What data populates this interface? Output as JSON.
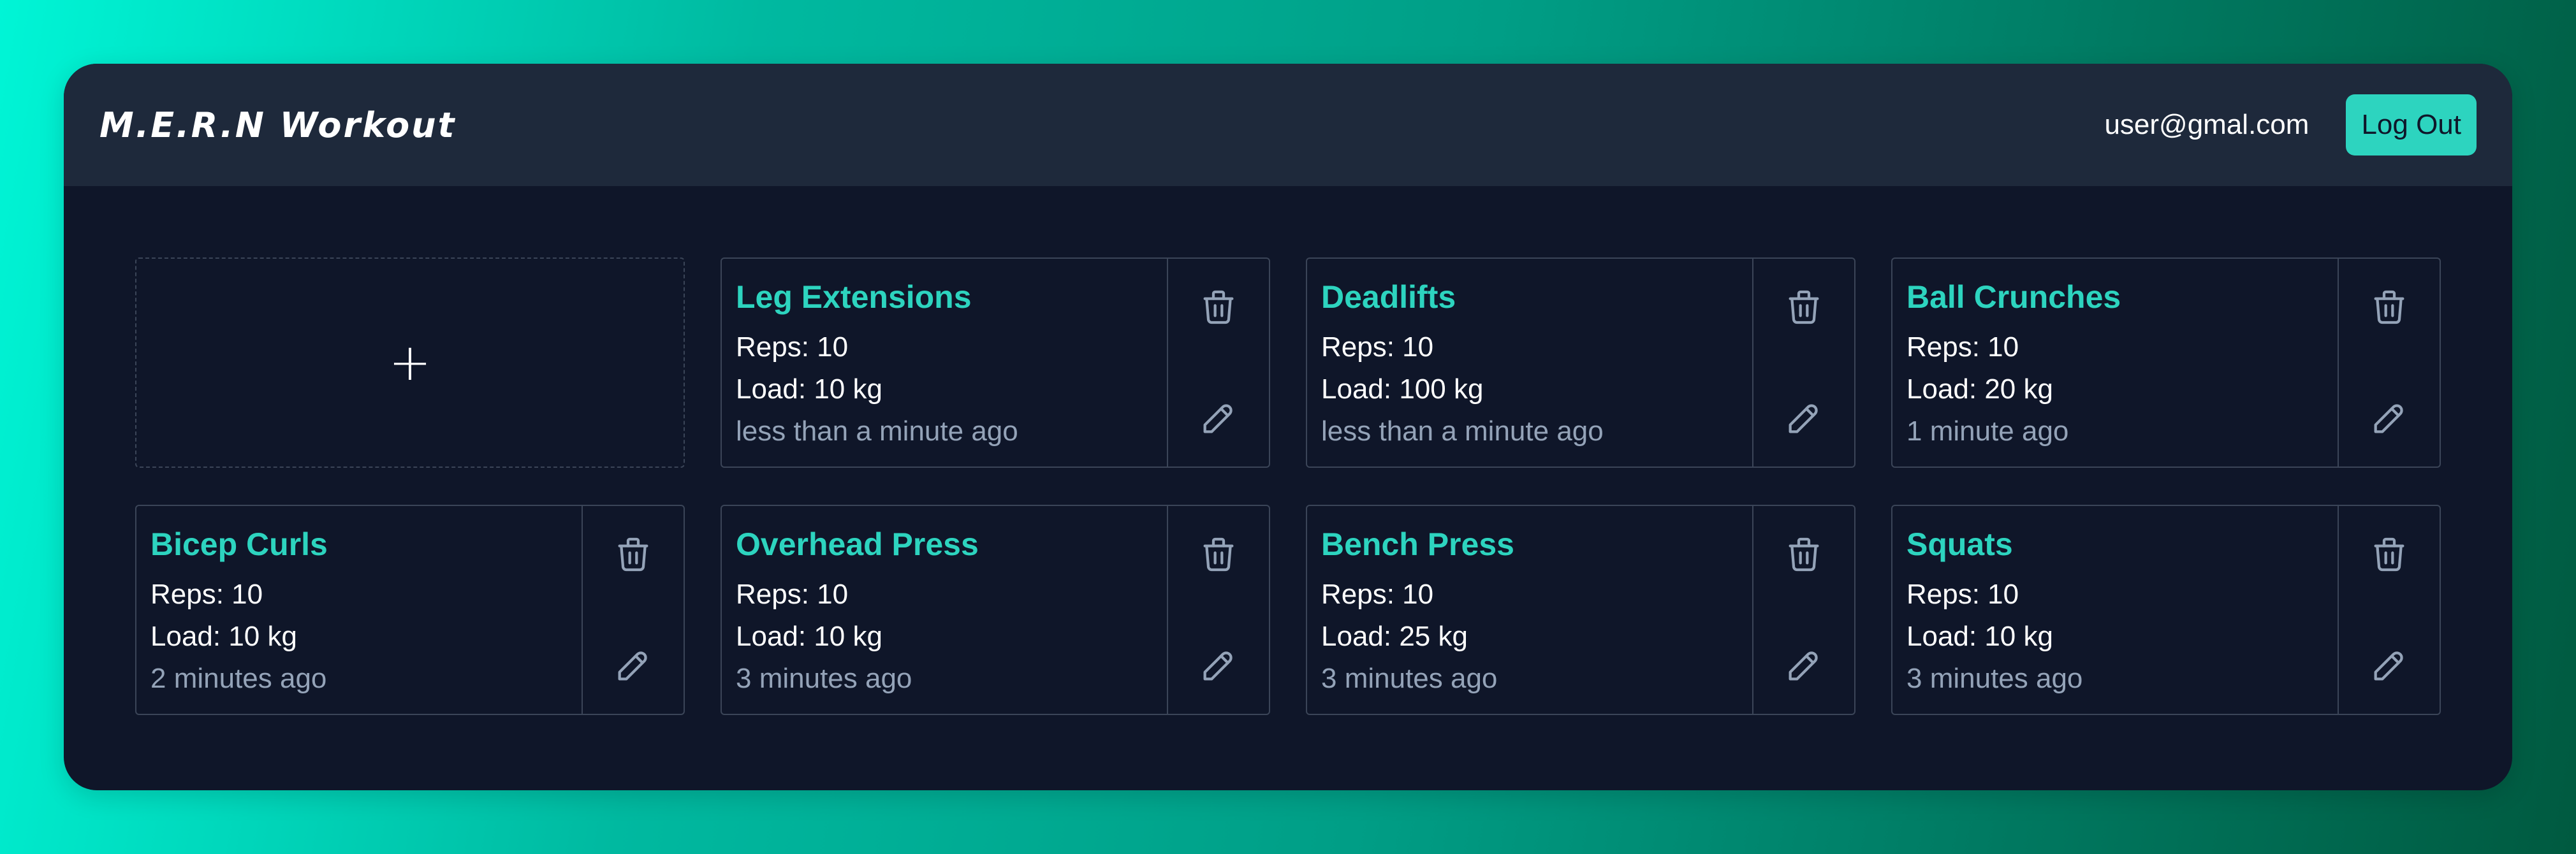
{
  "navbar": {
    "brand": "M.E.R.N Workout",
    "user_email": "user@gmal.com",
    "logout_label": "Log Out"
  },
  "add_card": {
    "icon": "plus-icon",
    "symbol": "+"
  },
  "workouts": [
    {
      "title": "Leg Extensions",
      "reps": "Reps: 10",
      "load": "Load: 10 kg",
      "time": "less than a minute ago"
    },
    {
      "title": "Deadlifts",
      "reps": "Reps: 10",
      "load": "Load: 100 kg",
      "time": "less than a minute ago"
    },
    {
      "title": "Ball Crunches",
      "reps": "Reps: 10",
      "load": "Load: 20 kg",
      "time": "1 minute ago"
    },
    {
      "title": "Bicep Curls",
      "reps": "Reps: 10",
      "load": "Load: 10 kg",
      "time": "2 minutes ago"
    },
    {
      "title": "Overhead Press",
      "reps": "Reps: 10",
      "load": "Load: 10 kg",
      "time": "3 minutes ago"
    },
    {
      "title": "Bench Press",
      "reps": "Reps: 10",
      "load": "Load: 25 kg",
      "time": "3 minutes ago"
    },
    {
      "title": "Squats",
      "reps": "Reps: 10",
      "load": "Load: 10 kg",
      "time": "3 minutes ago"
    }
  ],
  "icons": {
    "delete": "trash-icon",
    "edit": "pencil-icon"
  },
  "colors": {
    "accent": "#2dd4bf",
    "panel": "#0f1629",
    "navbar": "#1e293b",
    "muted": "#94a3b8"
  }
}
